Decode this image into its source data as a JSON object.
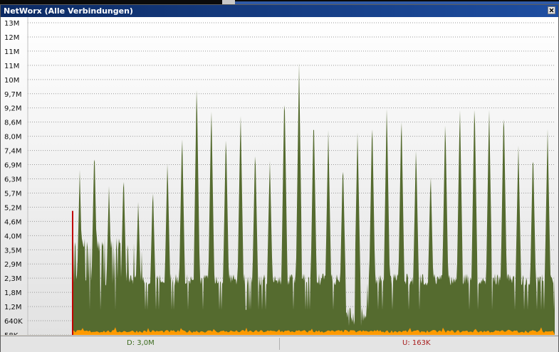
{
  "window": {
    "title": "NetWorx (Alle Verbindungen)"
  },
  "status": {
    "download": "D: 3,0M",
    "upload": "U: 163K"
  },
  "colors": {
    "download_fill": "#556b2f",
    "upload_fill": "#ff9a00",
    "spike_red": "#c00000",
    "grid": "#9a9a9a",
    "title_bar": "#0c2a63"
  },
  "chart_data": {
    "type": "area",
    "title": "",
    "xlabel": "",
    "ylabel": "",
    "y_ticks": [
      "13M",
      "12M",
      "11M",
      "11M",
      "10M",
      "9,7M",
      "9,2M",
      "8,6M",
      "8,0M",
      "7,4M",
      "6,9M",
      "6,3M",
      "5,7M",
      "5,2M",
      "4,6M",
      "4,0M",
      "3,5M",
      "2,9M",
      "2,3M",
      "1,8M",
      "1,2M",
      "640K",
      "58K"
    ],
    "ylim_bytes_per_s": [
      58000,
      13000000
    ],
    "grid": true,
    "series": [
      {
        "name": "D",
        "color": "#556b2f",
        "baseline_values_M": [
          2.6,
          2.3,
          2.0
        ],
        "spike_values_M": [
          6.9,
          8.0,
          6.3,
          6.9,
          5.7,
          6.3,
          7.4,
          8.6,
          10.7,
          9.7,
          8.6,
          9.4,
          8.0,
          7.4,
          10.4,
          11.4,
          9.4,
          8.6,
          7.4,
          8.6,
          9.2,
          9.7,
          9.4,
          8.0,
          6.9,
          9.2,
          9.7,
          10.0,
          9.6,
          9.7,
          8.0,
          7.9,
          8.6
        ]
      },
      {
        "name": "U",
        "color": "#ff9a00",
        "baseline_values_K": [
          163
        ]
      }
    ],
    "start_spike": {
      "color": "#c00000",
      "value_M": 5.2
    }
  }
}
